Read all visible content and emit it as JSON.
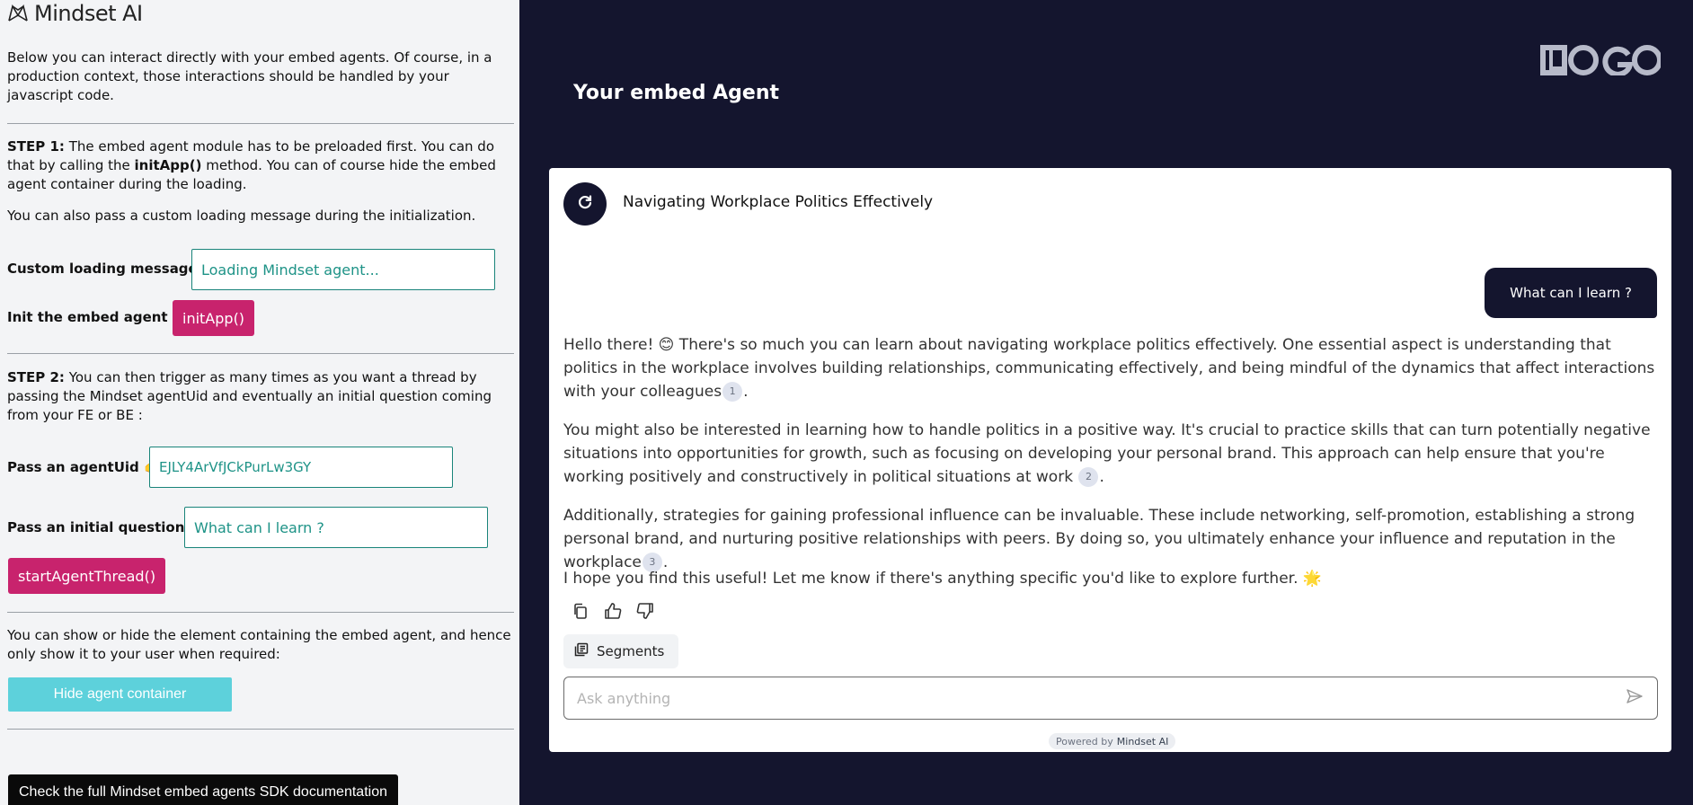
{
  "left": {
    "brand": "Mindset AI",
    "intro": "Below you can interact directly with your embed agents. Of course, in a production context, those interactions should be handled by your javascript code.",
    "step1": {
      "label": "STEP 1:",
      "text_a": " The embed agent module has to be preloaded first. You can do that by calling the ",
      "method": "initApp()",
      "text_b": " method. You can of course hide the embed agent container during the loading.",
      "note": "You can also pass a custom loading message during the initialization.",
      "loading_label": "Custom loading message:",
      "loading_value": "Loading Mindset agent...",
      "init_label": "Init the embed agent 👉",
      "init_button": "initApp()"
    },
    "step2": {
      "label": "STEP 2:",
      "text": " You can then trigger as many times as you want a thread by passing the Mindset agentUid and eventually an initial question coming from your FE or BE :",
      "agent_label": "Pass an agentUid 👉",
      "agent_value": "EJLY4ArVfJCkPurLw3GY",
      "question_label": "Pass an initial question 👉",
      "question_value": "What can I learn ?",
      "start_button": "startAgentThread()"
    },
    "visibility_text": "You can show or hide the element containing the embed agent, and hence only show it to your user when required:",
    "hide_button": "Hide agent container",
    "docs_button": "Check the full Mindset embed agents SDK documentation"
  },
  "right": {
    "title": "Your embed Agent",
    "logo_alt": "LOGO",
    "thread_title": "Navigating Workplace Politics Effectively",
    "user_message": "What can I learn ?",
    "para1": "Hello there! 😊 There's so much you can learn about navigating workplace politics effectively. One essential aspect is understanding that politics in the workplace involves building relationships, communicating effectively, and being mindful of the dynamics that affect interactions with your colleagues",
    "para2": "You might also be interested in learning how to handle politics in a positive way. It's crucial to practice skills that can turn potentially negative situations into opportunities for growth, such as focusing on developing your personal brand. This approach can help ensure that you're working positively and constructively in political situations at work ",
    "para3": "Additionally, strategies for gaining professional influence can be invaluable. These include networking, self-promotion, establishing a strong personal brand, and nurturing positive relationships with peers. By doing so, you ultimately enhance your influence and reputation in the workplace",
    "para4": "I hope you find this useful! Let me know if there's anything specific you'd like to explore further. 🌟",
    "cite1": "1",
    "cite2": "2",
    "cite3": "3",
    "period": ".",
    "segments_label": "Segments",
    "ask_placeholder": "Ask anything",
    "powered_prefix": "Powered by",
    "powered_brand": "Mindset AI",
    "icons": [
      "reload-icon",
      "copy-icon",
      "thumbs-up-icon",
      "thumbs-down-icon",
      "segments-icon",
      "send-icon"
    ]
  }
}
